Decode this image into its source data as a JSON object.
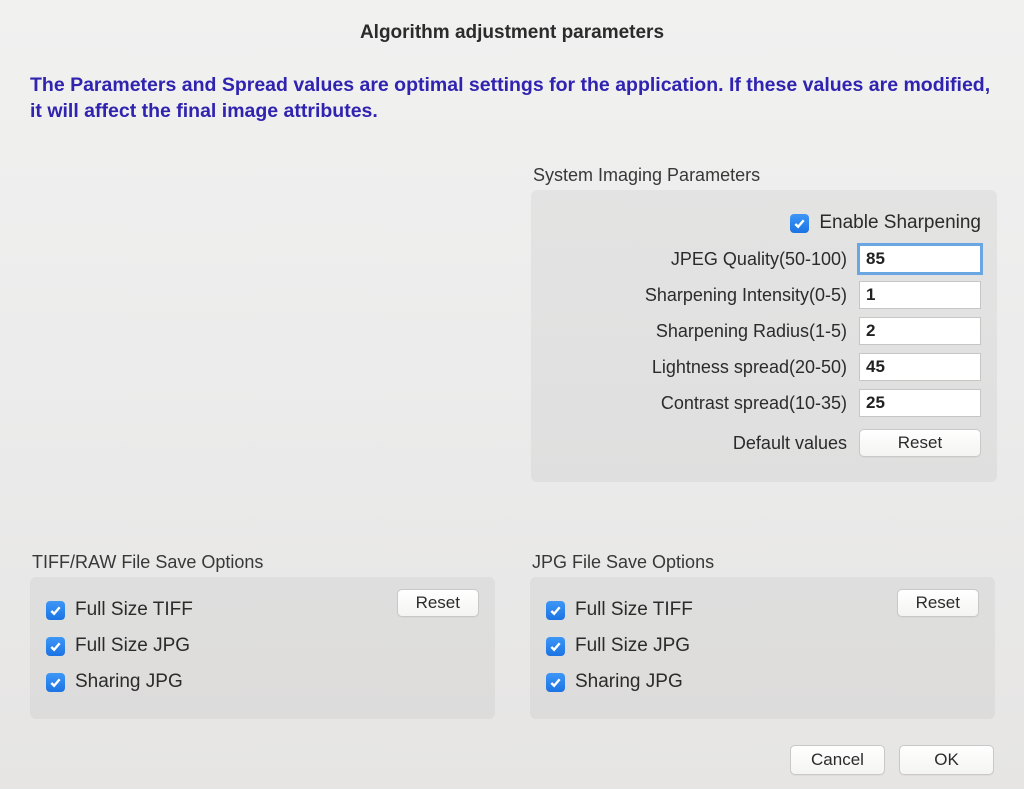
{
  "title": "Algorithm adjustment parameters",
  "warning": "The Parameters and Spread values are optimal settings for the application.  If these values are modified, it will affect the final image attributes.",
  "sys": {
    "group_title": "System Imaging Parameters",
    "enable_sharpening_label": "Enable Sharpening",
    "enable_sharpening_checked": true,
    "jpeg_quality_label": "JPEG Quality(50-100)",
    "jpeg_quality_value": "85",
    "sharpen_intensity_label": "Sharpening Intensity(0-5)",
    "sharpen_intensity_value": "1",
    "sharpen_radius_label": "Sharpening Radius(1-5)",
    "sharpen_radius_value": "2",
    "lightness_spread_label": "Lightness spread(20-50)",
    "lightness_spread_value": "45",
    "contrast_spread_label": "Contrast spread(10-35)",
    "contrast_spread_value": "25",
    "default_values_label": "Default values",
    "reset_label": "Reset"
  },
  "tiff": {
    "group_title": "TIFF/RAW File Save Options",
    "full_tiff_label": "Full Size TIFF",
    "full_jpg_label": "Full Size JPG",
    "sharing_jpg_label": "Sharing JPG",
    "reset_label": "Reset"
  },
  "jpg": {
    "group_title": "JPG File Save Options",
    "full_tiff_label": "Full Size TIFF",
    "full_jpg_label": "Full Size JPG",
    "sharing_jpg_label": "Sharing JPG",
    "reset_label": "Reset"
  },
  "actions": {
    "cancel_label": "Cancel",
    "ok_label": "OK"
  }
}
